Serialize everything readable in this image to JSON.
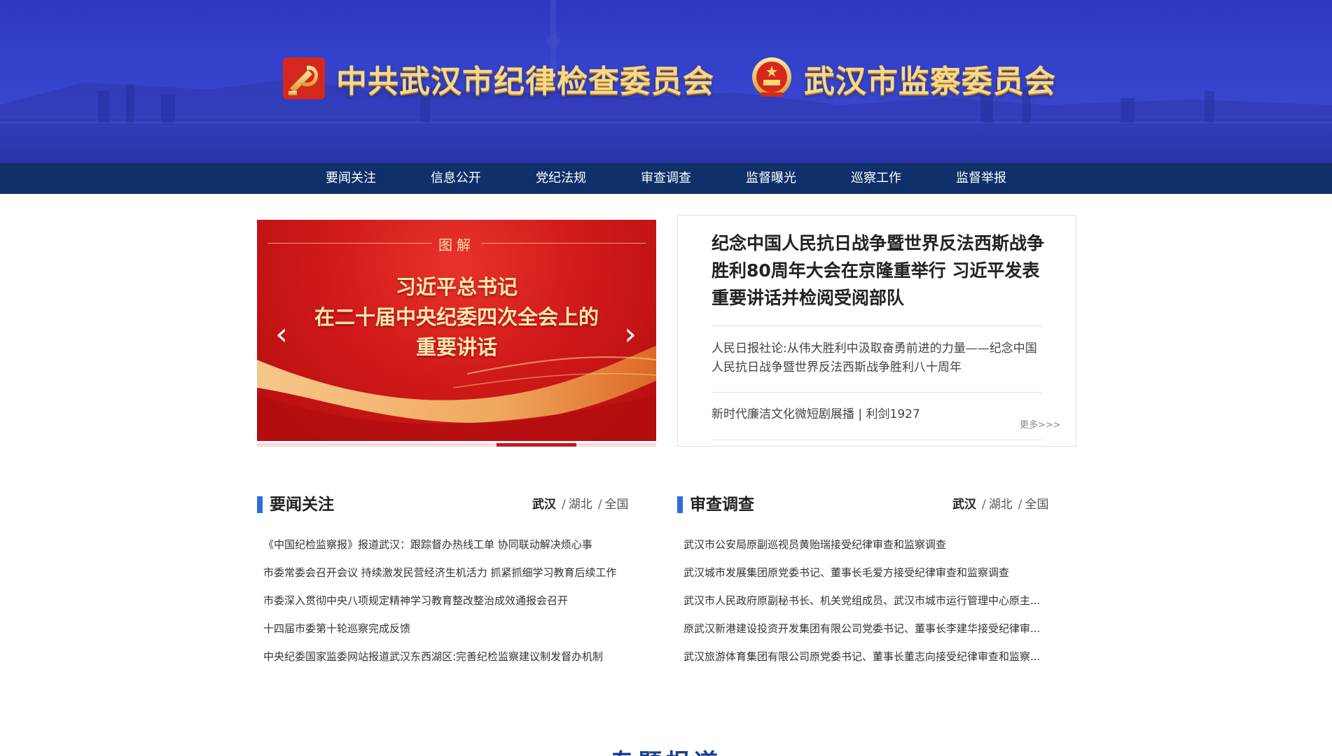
{
  "header": {
    "brand_left": "中共武汉市纪律检查委员会",
    "brand_right": "武汉市监察委员会",
    "colors": {
      "banner": "#3543cc",
      "brand_text": "#f7d988"
    }
  },
  "nav": {
    "items": [
      {
        "label": "要闻关注"
      },
      {
        "label": "信息公开"
      },
      {
        "label": "党纪法规"
      },
      {
        "label": "审查调查"
      },
      {
        "label": "监督曝光"
      },
      {
        "label": "巡察工作"
      },
      {
        "label": "监督举报"
      }
    ],
    "color": "#0f3068"
  },
  "slider": {
    "kicker": "图解",
    "title_line1": "习近平总书记",
    "title_line2": "在二十届中央纪委四次全会上的",
    "title_line3": "重要讲话",
    "prev_icon": "chevron-left-icon",
    "next_icon": "chevron-right-icon",
    "active_slide_index": 4,
    "slide_count": 5
  },
  "headline": {
    "title": "纪念中国人民抗日战争暨世界反法西斯战争胜利80周年大会在京隆重举行 习近平发表重要讲话并检阅受阅部队",
    "items": [
      "人民日报社论:从伟大胜利中汲取奋勇前进的力量——纪念中国人民抗日战争暨世界反法西斯战争胜利八十周年",
      "新时代廉洁文化微短剧展播 | 利剑1927"
    ],
    "more": "更多>>>"
  },
  "news_left": {
    "title": "要闻关注",
    "tabs": [
      "武汉",
      "湖北",
      "全国"
    ],
    "active_tab": "武汉",
    "items": [
      "《中国纪检监察报》报道武汉：跟踪督办热线工单 协同联动解决烦心事",
      "市委常委会召开会议 持续激发民营经济生机活力 抓紧抓细学习教育后续工作",
      "市委深入贯彻中央八项规定精神学习教育整改整治成效通报会召开",
      "十四届市委第十轮巡察完成反馈",
      "中央纪委国家监委网站报道武汉东西湖区:完善纪检监察建议制发督办机制"
    ]
  },
  "news_right": {
    "title": "审查调查",
    "tabs": [
      "武汉",
      "湖北",
      "全国"
    ],
    "active_tab": "武汉",
    "items": [
      "武汉市公安局原副巡视员黄贻瑞接受纪律审查和监察调查",
      "武汉城市发展集团原党委书记、董事长毛爱方接受纪律审查和监察调查",
      "武汉市人民政府原副秘书长、机关党组成员、武汉市城市运行管理中心原主...",
      "原武汉新港建设投资开发集团有限公司党委书记、董事长李建华接受纪律审...",
      "武汉旅游体育集团有限公司原党委书记、董事长董志向接受纪律审查和监察..."
    ]
  },
  "section": {
    "heading": "专题报道"
  },
  "accent": "#2f6be0"
}
